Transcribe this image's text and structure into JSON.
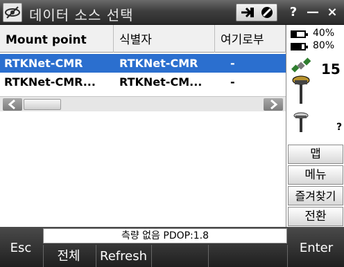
{
  "title": "데이터 소스 선택",
  "titlebar": {
    "help": "?",
    "minimize": "—",
    "close": "×"
  },
  "table": {
    "columns": [
      "Mount point",
      "식별자",
      "여기로부"
    ],
    "rows": [
      {
        "mount": "RTKNet-CMR",
        "id": "RTKNet-CMR",
        "dist": "-",
        "selected": true
      },
      {
        "mount": "RTKNet-CMR...",
        "id": "RTKNet-CM...",
        "dist": "-",
        "selected": false
      }
    ]
  },
  "status_panel": {
    "battery1": "40%",
    "battery2": "80%",
    "battery1_level": 0.4,
    "battery2_level": 0.8,
    "satellites": "15",
    "rover_status": "?"
  },
  "side_buttons": [
    "맵",
    "메뉴",
    "즐겨찾기",
    "전환"
  ],
  "bottom": {
    "status": "측량 없음  PDOP:1.8",
    "esc": "Esc",
    "all": "전체",
    "refresh": "Refresh",
    "enter": "Enter"
  },
  "icons": [
    "app-logo-icon",
    "arrow-in-icon",
    "no-entry-icon",
    "battery-icon",
    "satellite-icon",
    "gnss-antenna-icon",
    "chevron-left-icon",
    "chevron-right-icon"
  ]
}
